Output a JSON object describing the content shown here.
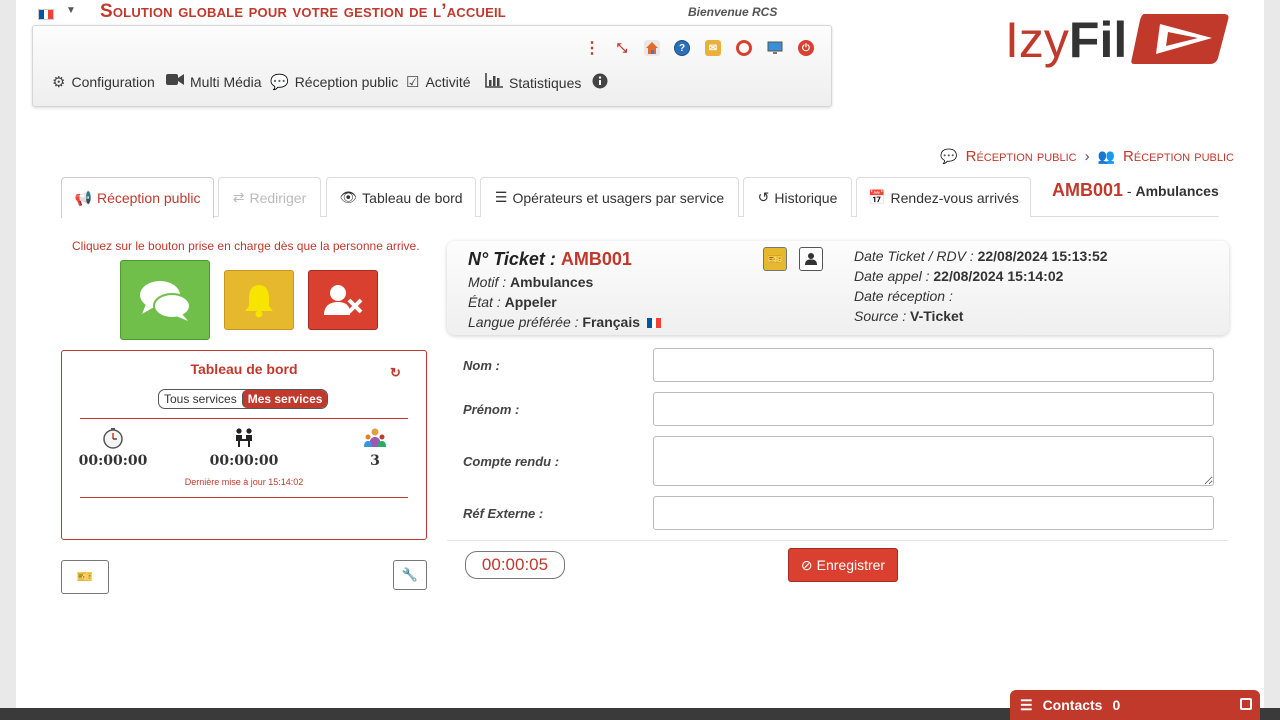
{
  "header": {
    "title": "Solution globale pour votre gestion de l’accueil",
    "welcome": "Bienvenue RCS",
    "lang_flag": [
      "#0055A4",
      "#FFFFFF",
      "#EF4135"
    ]
  },
  "logo": {
    "part1": "Izy",
    "part2": "Fil",
    "color": "#c0392b"
  },
  "toolbar_icons": [
    "more-vert-icon",
    "minimize-icon",
    "home-icon",
    "help-icon",
    "mail-icon",
    "lifebuoy-icon",
    "monitor-icon",
    "power-icon"
  ],
  "nav": {
    "configuration": "Configuration",
    "multimedia": "Multi Média",
    "reception": "Réception public",
    "activite": "Activité",
    "statistiques": "Statistiques"
  },
  "breadcrumb": [
    "Réception public",
    "Réception public"
  ],
  "tabs": {
    "reception": "Réception public",
    "rediriger": "Rediriger",
    "tableau": "Tableau de bord",
    "operateurs": "Opérateurs et usagers par service",
    "historique": "Historique",
    "rdv": "Rendez-vous arrivés"
  },
  "current_ticket": {
    "number": "AMB001",
    "separator": " - ",
    "service": "Ambulances"
  },
  "hint": "Cliquez sur le bouton prise en charge dès que la personne arrive.",
  "dashboard": {
    "title": "Tableau de bord",
    "toggle_all": "Tous services",
    "toggle_mine": "Mes services",
    "wait_time": "00:00:00",
    "process_time": "00:00:00",
    "count": "3",
    "last_update": "Dernière mise à jour 15:14:02"
  },
  "ticket": {
    "number_label": "N° Ticket :",
    "number": "AMB001",
    "motif_label": "Motif :",
    "motif": "Ambulances",
    "etat_label": "État :",
    "etat": "Appeler",
    "langue_label": "Langue préférée :",
    "langue": "Français",
    "date_ticket_label": "Date Ticket / RDV :",
    "date_ticket": "22/08/2024 15:13:52",
    "date_appel_label": "Date appel :",
    "date_appel": "22/08/2024 15:14:02",
    "date_reception_label": "Date réception :",
    "date_reception": "",
    "source_label": "Source :",
    "source": "V-Ticket"
  },
  "form": {
    "nom_label": "Nom :",
    "nom": "",
    "prenom_label": "Prénom :",
    "prenom": "",
    "compte_rendu_label": "Compte rendu :",
    "compte_rendu": "",
    "ref_externe_label": "Réf Externe :",
    "ref_externe": ""
  },
  "timer": "00:00:05",
  "save_label": "Enregistrer",
  "contacts": {
    "label": "Contacts",
    "count": "0"
  },
  "colors": {
    "accent": "#c0392b",
    "green": "#6fbf4a",
    "yellow": "#e6b82e",
    "red": "#d9402f"
  }
}
